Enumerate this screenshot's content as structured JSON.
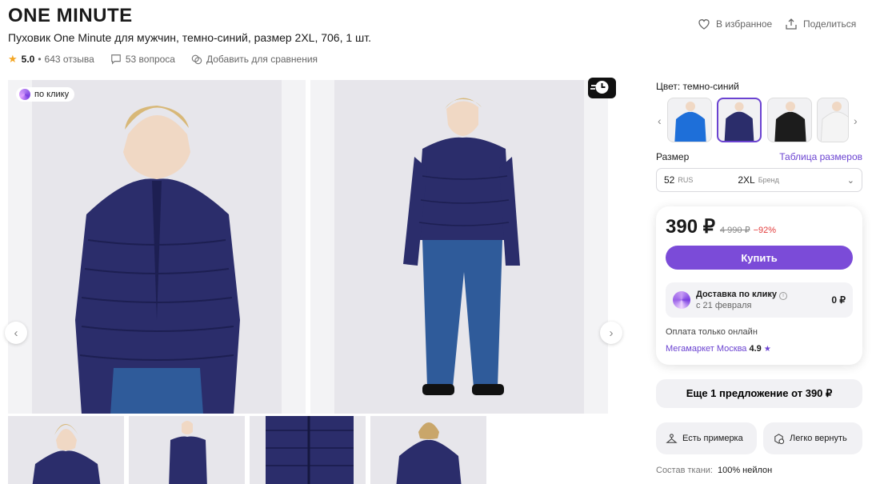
{
  "header": {
    "brand": "ONE MINUTE",
    "title": "Пуховик One Minute для мужчин, темно-синий, размер 2XL, 706, 1 шт.",
    "rating": "5.0",
    "reviews": "643 отзыва",
    "questions": "53 вопроса",
    "compare": "Добавить для сравнения",
    "favorite": "В избранное",
    "share": "Поделиться"
  },
  "gallery": {
    "badge": "по клику",
    "prev_icon": "‹",
    "next_icon": "›"
  },
  "options": {
    "color_label": "Цвет: темно-синий",
    "size_label": "Размер",
    "size_table": "Таблица размеров",
    "size_value": "52",
    "size_system": "RUS",
    "size_brand_value": "2XL",
    "size_brand_label": "Бренд"
  },
  "buy": {
    "price": "390 ₽",
    "old_price": "4 990 ₽",
    "discount": "−92%",
    "button": "Купить",
    "delivery_title": "Доставка по клику",
    "delivery_date": "с 21 февраля",
    "delivery_price": "0 ₽",
    "payment": "Оплата только онлайн",
    "seller": "Мегамаркет Москва",
    "seller_rating": "4.9",
    "seller_star": "★"
  },
  "extras": {
    "offer": "Еще 1 предложение от 390 ₽",
    "fitting": "Есть примерка",
    "return": "Легко вернуть",
    "fabric_label": "Состав ткани:",
    "fabric_value": "100% нейлон"
  },
  "colors": {
    "accent": "#7b4bd8",
    "discount": "#e23b3b",
    "jacket_navy": "#2b2d6b",
    "jacket_blue": "#1e6fd9"
  }
}
